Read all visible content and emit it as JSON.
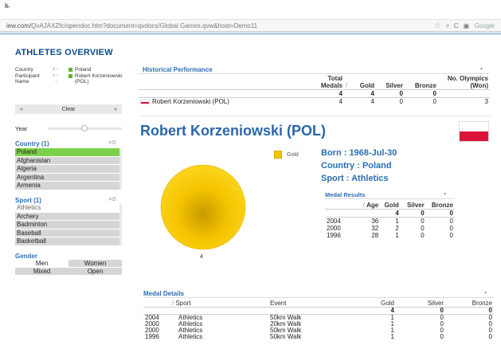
{
  "browser": {
    "cursor": "k̵",
    "url_prefix": "iew.com/",
    "url_rest": "QvAJAXZfc/opendoc.htm?document=qvdocs/Global Games.qvw&host=Demo11",
    "search_placeholder": "Google"
  },
  "left": {
    "title": "ATHLETES OVERVIEW",
    "selections": {
      "labels": [
        "Country",
        "Participant",
        "Name"
      ],
      "values": [
        "Poland",
        "Robert Korzeniowski (POL)"
      ]
    },
    "nav": {
      "prev": "«",
      "clear": "Clear",
      "next": "»"
    },
    "year_label": "Year",
    "country": {
      "header": "Country (1)",
      "items": [
        "Poland",
        "Afghanistan",
        "Algeria",
        "Argentina",
        "Armenia"
      ]
    },
    "sport": {
      "header": "Sport (1)",
      "items": [
        "Athletics",
        "Archery",
        "Badminton",
        "Baseball",
        "Basketball"
      ]
    },
    "gender": {
      "header": "Gender",
      "options": [
        "Men",
        "Women",
        "Mixed",
        "Open"
      ]
    }
  },
  "historical": {
    "header": "Historical Performance",
    "columns": [
      "Total Medals",
      "Gold",
      "Silver",
      "Bronze",
      "No. Olympics (Won)"
    ],
    "totals": [
      "4",
      "4",
      "0",
      "0",
      ""
    ],
    "rows": [
      {
        "name": "Robert Korzeniowski (POL)",
        "values": [
          "4",
          "4",
          "0",
          "0",
          "3"
        ]
      }
    ]
  },
  "athlete": {
    "name": "Robert Korzeniowski (POL)",
    "born": "Born : 1968-Jul-30",
    "country": "Country : Poland",
    "sport": "Sport : Athletics"
  },
  "chart_data": {
    "type": "pie",
    "categories": [
      "Gold"
    ],
    "values": [
      4
    ],
    "title": "",
    "legend_position": "top-right",
    "colors": {
      "Gold": "#f5c400"
    },
    "data_label": "4"
  },
  "medal_results": {
    "header": "Medal Results",
    "columns": [
      "Age",
      "Gold",
      "Silver",
      "Bronze"
    ],
    "totals": [
      "",
      "4",
      "0",
      "0"
    ],
    "rows": [
      {
        "year": "2004",
        "values": [
          "36",
          "1",
          "0",
          "0"
        ]
      },
      {
        "year": "2000",
        "values": [
          "32",
          "2",
          "0",
          "0"
        ]
      },
      {
        "year": "1996",
        "values": [
          "28",
          "1",
          "0",
          "0"
        ]
      }
    ]
  },
  "medal_details": {
    "header": "Medal Details",
    "columns": [
      "Sport",
      "Event",
      "Gold",
      "Silver",
      "Bronze"
    ],
    "totals": [
      "",
      "",
      "4",
      "0",
      "0"
    ],
    "rows": [
      {
        "year": "2004",
        "sport": "Athletics",
        "event": "50km Walk",
        "gold": "1",
        "silver": "0",
        "bronze": "0"
      },
      {
        "year": "2000",
        "sport": "Athletics",
        "event": "20km Walk",
        "gold": "1",
        "silver": "0",
        "bronze": "0"
      },
      {
        "year": "2000",
        "sport": "Athletics",
        "event": "50km Walk",
        "gold": "1",
        "silver": "0",
        "bronze": "0"
      },
      {
        "year": "1996",
        "sport": "Athletics",
        "event": "50km Walk",
        "gold": "1",
        "silver": "0",
        "bronze": "0"
      }
    ]
  },
  "colors": {
    "accent": "#2c6eb3",
    "selected": "#7cd14b",
    "gold": "#f5c400",
    "flag_red": "#dc143c"
  }
}
